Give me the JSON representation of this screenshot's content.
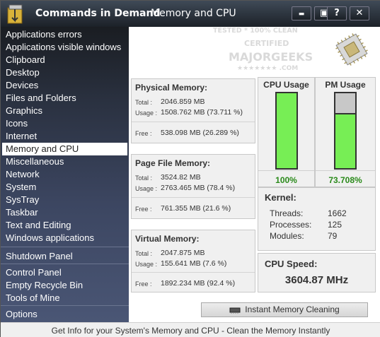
{
  "window": {
    "app_title": "Commands in Demand",
    "separator": "-",
    "page_title": "Memory and CPU",
    "controls": [
      {
        "name": "minimize-button",
        "icon": "minimize-icon",
        "glyph": "▬"
      },
      {
        "name": "restore-button",
        "icon": "restore-icon",
        "glyph": "▣"
      },
      {
        "name": "help-button",
        "icon": "help-icon",
        "glyph": "?"
      },
      {
        "name": "close-button",
        "icon": "close-icon",
        "glyph": "✕"
      }
    ]
  },
  "watermark": {
    "line1": "TESTED * 100% CLEAN",
    "line2": "CERTIFIED",
    "line3": "MAJORGEEKS",
    "line4": "★★★★★★★ .COM"
  },
  "sidebar": {
    "items": [
      {
        "label": "Applications errors"
      },
      {
        "label": "Applications visible windows"
      },
      {
        "label": "Clipboard"
      },
      {
        "label": "Desktop"
      },
      {
        "label": "Devices"
      },
      {
        "label": "Files and Folders"
      },
      {
        "label": "Graphics"
      },
      {
        "label": "Icons"
      },
      {
        "label": "Internet"
      },
      {
        "label": "Memory and CPU",
        "active": true
      },
      {
        "label": "Miscellaneous"
      },
      {
        "label": "Network"
      },
      {
        "label": "System"
      },
      {
        "label": "SysTray"
      },
      {
        "label": "Taskbar"
      },
      {
        "label": "Text and Editing"
      },
      {
        "label": "Windows applications"
      }
    ],
    "group2": [
      {
        "label": "Shutdown Panel"
      }
    ],
    "group3": [
      {
        "label": "Control Panel"
      },
      {
        "label": "Empty Recycle Bin"
      },
      {
        "label": "Tools of Mine"
      }
    ],
    "group4": [
      {
        "label": "Options"
      }
    ]
  },
  "physical": {
    "title": "Physical Memory:",
    "total_label": "Total :",
    "total_value": "2046.859 MB",
    "usage_label": "Usage :",
    "usage_value": "1508.762 MB (73.711 %)",
    "free_label": "Free :",
    "free_value": "538.098 MB (26.289 %)"
  },
  "pagefile": {
    "title": "Page File Memory:",
    "total_label": "Total :",
    "total_value": "3524.82 MB",
    "usage_label": "Usage :",
    "usage_value": "2763.465 MB (78.4 %)",
    "free_label": "Free :",
    "free_value": "761.355 MB (21.6 %)"
  },
  "virtual": {
    "title": "Virtual Memory:",
    "total_label": "Total :",
    "total_value": "2047.875 MB",
    "usage_label": "Usage :",
    "usage_value": "155.641 MB (7.6 %)",
    "free_label": "Free :",
    "free_value": "1892.234 MB (92.4 %)"
  },
  "cpu_usage": {
    "title": "CPU Usage",
    "percent_text": "100%",
    "fraction": 1.0
  },
  "pm_usage": {
    "title": "PM Usage",
    "percent_text": "73.708%",
    "fraction": 0.73708
  },
  "kernel": {
    "title": "Kernel:",
    "threads_label": "Threads:",
    "threads_value": "1662",
    "processes_label": "Processes:",
    "processes_value": "125",
    "modules_label": "Modules:",
    "modules_value": "79"
  },
  "cpu_speed": {
    "title": "CPU Speed:",
    "value": "3604.87 MHz"
  },
  "clean_button": {
    "label": "Instant Memory Cleaning",
    "icon": "memory-chip-icon"
  },
  "status": {
    "text": "Get Info for your System's Memory and CPU - Clean the Memory Instantly"
  },
  "colors": {
    "gauge_fill": "#77ee55",
    "gauge_empty": "#c8c8c8",
    "pct_text": "#2a8a1a"
  }
}
